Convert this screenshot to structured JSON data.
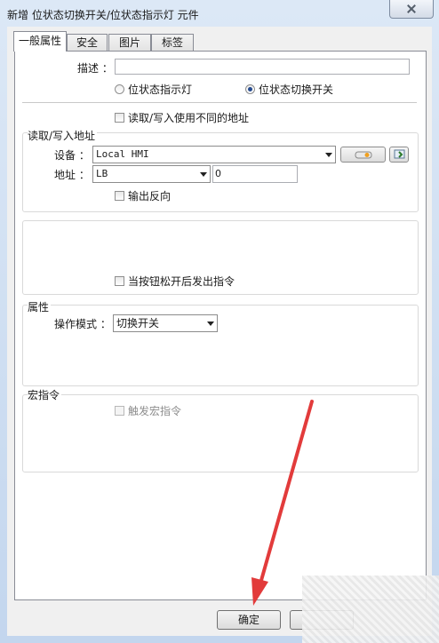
{
  "window": {
    "title": "新增 位状态切换开关/位状态指示灯 元件"
  },
  "tabs": [
    {
      "label": "一般属性"
    },
    {
      "label": "安全"
    },
    {
      "label": "图片"
    },
    {
      "label": "标签"
    }
  ],
  "general": {
    "description_label": "描述 ：",
    "description_value": "",
    "radio_indicator": "位状态指示灯",
    "radio_switch": "位状态切换开关",
    "selected_radio": "位状态切换开关",
    "diff_address_label": "读取/写入使用不同的地址"
  },
  "rw_address": {
    "group_label": "读取/写入地址",
    "device_label": "设备 ：",
    "device_value": "Local HMI",
    "address_label": "地址 ：",
    "address_type": "LB",
    "address_value": "0",
    "invert_label": "输出反向"
  },
  "release": {
    "label": "当按钮松开后发出指令"
  },
  "attributes": {
    "group_label": "属性",
    "mode_label": "操作模式 ：",
    "mode_value": "切换开关"
  },
  "macro": {
    "group_label": "宏指令",
    "trigger_label": "触发宏指令"
  },
  "footer": {
    "ok_label": "确定"
  },
  "colors": {
    "annotation_arrow": "#e23b3b",
    "accent": "#254a8f"
  }
}
